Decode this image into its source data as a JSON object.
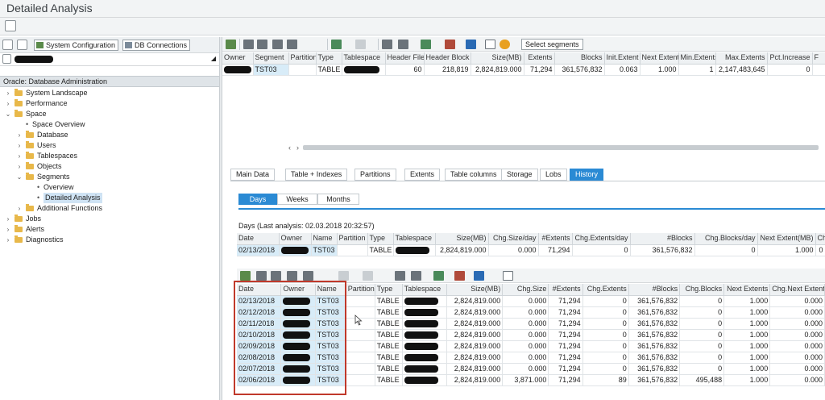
{
  "window": {
    "title": "Detailed Analysis"
  },
  "left_panel": {
    "buttons": [
      {
        "label": "System Configuration",
        "icon": "system-config-icon"
      },
      {
        "label": "DB Connections",
        "icon": "db-connections-icon"
      }
    ],
    "tree_header": "Oracle: Database Administration",
    "tree": [
      {
        "label": "System Landscape",
        "level": 0,
        "expander": "›",
        "folder": true
      },
      {
        "label": "Performance",
        "level": 0,
        "expander": "›",
        "folder": true
      },
      {
        "label": "Space",
        "level": 0,
        "expander": "⌄",
        "folder": true
      },
      {
        "label": "Space Overview",
        "level": 1,
        "expander": "",
        "folder": false
      },
      {
        "label": "Database",
        "level": 1,
        "expander": "›",
        "folder": true
      },
      {
        "label": "Users",
        "level": 1,
        "expander": "›",
        "folder": true
      },
      {
        "label": "Tablespaces",
        "level": 1,
        "expander": "›",
        "folder": true
      },
      {
        "label": "Objects",
        "level": 1,
        "expander": "›",
        "folder": true
      },
      {
        "label": "Segments",
        "level": 1,
        "expander": "⌄",
        "folder": true
      },
      {
        "label": "Overview",
        "level": 2,
        "expander": "",
        "folder": false
      },
      {
        "label": "Detailed Analysis",
        "level": 2,
        "expander": "",
        "folder": false,
        "selected": true
      },
      {
        "label": "Additional Functions",
        "level": 1,
        "expander": "›",
        "folder": true
      },
      {
        "label": "Jobs",
        "level": 0,
        "expander": "›",
        "folder": true
      },
      {
        "label": "Alerts",
        "level": 0,
        "expander": "›",
        "folder": true
      },
      {
        "label": "Diagnostics",
        "level": 0,
        "expander": "›",
        "folder": true
      }
    ]
  },
  "top_toolbar": {
    "select_segments_label": "Select segments"
  },
  "segment_table": {
    "columns": [
      "Owner",
      "Segment",
      "Partition",
      "Type",
      "Tablespace",
      "Header File",
      "Header Block",
      "Size(MB)",
      "Extents",
      "Blocks",
      "Init.Extent",
      "Next Extent",
      "Min.Extents",
      "Max.Extents",
      "Pct.Increase",
      "F"
    ],
    "rows": [
      [
        "",
        "TST03",
        "",
        "TABLE",
        "",
        "60",
        "218,819",
        "2,824,819.000",
        "71,294",
        "361,576,832",
        "0.063",
        "1.000",
        "1",
        "2,147,483,645",
        "0",
        ""
      ]
    ]
  },
  "tabs": [
    "Main Data",
    "Table + Indexes",
    "Partitions",
    "Extents",
    "Table columns",
    "Storage",
    "Lobs",
    "History"
  ],
  "active_tab": "History",
  "subtabs": [
    "Days",
    "Weeks",
    "Months"
  ],
  "active_subtab": "Days",
  "days_header": "Days   (Last analysis: 02.03.2018 20:32:57)",
  "summary_table": {
    "columns": [
      "Date",
      "Owner",
      "Name",
      "Partition",
      "Type",
      "Tablespace",
      "Size(MB)",
      "Chg.Size/day",
      "#Extents",
      "Chg.Extents/day",
      "#Blocks",
      "Chg.Blocks/day",
      "Next Extent(MB)",
      "Chg.Next Exte"
    ],
    "rows": [
      [
        "02/13/2018",
        "",
        "TST03",
        "",
        "TABLE",
        "",
        "2,824,819.000",
        "0.000",
        "71,294",
        "0",
        "361,576,832",
        "0",
        "1.000",
        "0"
      ]
    ]
  },
  "history_table": {
    "columns": [
      "Date",
      "Owner",
      "Name",
      "Partition",
      "Type",
      "Tablespace",
      "Size(MB)",
      "Chg.Size",
      "#Extents",
      "Chg.Extents",
      "#Blocks",
      "Chg.Blocks",
      "Next Extents",
      "Chg.Next Extent"
    ],
    "rows": [
      [
        "02/13/2018",
        "",
        "TST03",
        "",
        "TABLE",
        "",
        "2,824,819.000",
        "0.000",
        "71,294",
        "0",
        "361,576,832",
        "0",
        "1.000",
        "0.000"
      ],
      [
        "02/12/2018",
        "",
        "TST03",
        "",
        "TABLE",
        "",
        "2,824,819.000",
        "0.000",
        "71,294",
        "0",
        "361,576,832",
        "0",
        "1.000",
        "0.000"
      ],
      [
        "02/11/2018",
        "",
        "TST03",
        "",
        "TABLE",
        "",
        "2,824,819.000",
        "0.000",
        "71,294",
        "0",
        "361,576,832",
        "0",
        "1.000",
        "0.000"
      ],
      [
        "02/10/2018",
        "",
        "TST03",
        "",
        "TABLE",
        "",
        "2,824,819.000",
        "0.000",
        "71,294",
        "0",
        "361,576,832",
        "0",
        "1.000",
        "0.000"
      ],
      [
        "02/09/2018",
        "",
        "TST03",
        "",
        "TABLE",
        "",
        "2,824,819.000",
        "0.000",
        "71,294",
        "0",
        "361,576,832",
        "0",
        "1.000",
        "0.000"
      ],
      [
        "02/08/2018",
        "",
        "TST03",
        "",
        "TABLE",
        "",
        "2,824,819.000",
        "0.000",
        "71,294",
        "0",
        "361,576,832",
        "0",
        "1.000",
        "0.000"
      ],
      [
        "02/07/2018",
        "",
        "TST03",
        "",
        "TABLE",
        "",
        "2,824,819.000",
        "0.000",
        "71,294",
        "0",
        "361,576,832",
        "0",
        "1.000",
        "0.000"
      ],
      [
        "02/06/2018",
        "",
        "TST03",
        "",
        "TABLE",
        "",
        "2,824,819.000",
        "3,871.000",
        "71,294",
        "89",
        "361,576,832",
        "495,488",
        "1.000",
        "0.000"
      ]
    ]
  },
  "colors": {
    "accent": "#2a8ad4",
    "highlight_box": "#c0392b",
    "key_cell": "#d8ecf8"
  }
}
